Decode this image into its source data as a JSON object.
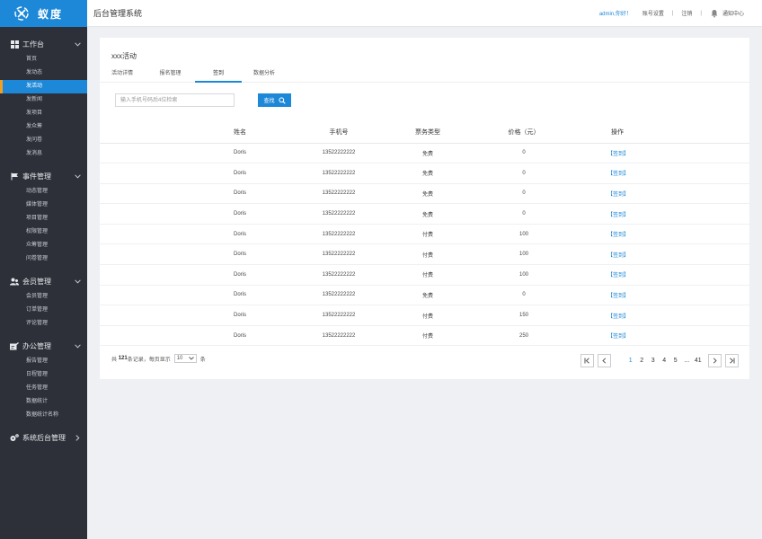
{
  "brand": {
    "name": "蚁度"
  },
  "header": {
    "title": "后台管理系统",
    "greeting": "admin,你好！",
    "account_settings": "账号设置",
    "separator": "|",
    "logout": "注销",
    "notifications": "通知中心"
  },
  "sidebar": {
    "groups": [
      {
        "title": "工作台",
        "icon": "dashboard-icon",
        "expanded": true,
        "items": [
          "首页",
          "发动态",
          "发活动",
          "发新闻",
          "发项目",
          "发众筹",
          "发问卷",
          "发消息"
        ],
        "active_index": 2
      },
      {
        "title": "事件管理",
        "icon": "flag-icon",
        "expanded": true,
        "items": [
          "动态管理",
          "媒体管理",
          "项目管理",
          "权限管理",
          "众筹管理",
          "问卷管理"
        ]
      },
      {
        "title": "会员管理",
        "icon": "users-icon",
        "expanded": true,
        "items": [
          "会员管理",
          "订单管理",
          "评论管理"
        ]
      },
      {
        "title": "办公管理",
        "icon": "office-icon",
        "expanded": true,
        "items": [
          "报告管理",
          "日程管理",
          "任务管理",
          "数据统计",
          "数据统计名称"
        ]
      },
      {
        "title": "系统后台管理",
        "icon": "gears-icon",
        "expanded": false,
        "items": []
      }
    ]
  },
  "main": {
    "activity_title": "xxx活动",
    "tabs": [
      "活动详情",
      "报名管理",
      "签到",
      "数据分析"
    ],
    "active_tab": 2,
    "search": {
      "placeholder": "输入手机号码后4位检索",
      "button_label": "查找",
      "value": ""
    },
    "table": {
      "columns": [
        "姓名",
        "手机号",
        "票务类型",
        "价格（元）",
        "操作"
      ],
      "rows": [
        [
          "Doris",
          "13522222222",
          "免费",
          "0",
          "【签到】"
        ],
        [
          "Doris",
          "13522222222",
          "免费",
          "0",
          "【签到】"
        ],
        [
          "Doris",
          "13522222222",
          "免费",
          "0",
          "【签到】"
        ],
        [
          "Doris",
          "13522222222",
          "免费",
          "0",
          "【签到】"
        ],
        [
          "Doris",
          "13522222222",
          "付费",
          "100",
          "【签到】"
        ],
        [
          "Doris",
          "13522222222",
          "付费",
          "100",
          "【签到】"
        ],
        [
          "Doris",
          "13522222222",
          "付费",
          "100",
          "【签到】"
        ],
        [
          "Doris",
          "13522222222",
          "免费",
          "0",
          "【签到】"
        ],
        [
          "Doris",
          "13522222222",
          "付费",
          "150",
          "【签到】"
        ],
        [
          "Doris",
          "13522222222",
          "付费",
          "250",
          "【签到】"
        ]
      ]
    },
    "footer": {
      "prefix": "共",
      "total": "121",
      "middle": "条记录，每页显示",
      "page_size": "10",
      "suffix": "条"
    },
    "pagination": {
      "pages": [
        "1",
        "2",
        "3",
        "4",
        "5",
        "...",
        "41"
      ],
      "current": "1"
    }
  },
  "colors": {
    "accent": "#1e88d8",
    "sidebar_bg": "#2d3038",
    "active_marker": "#f0a020"
  }
}
